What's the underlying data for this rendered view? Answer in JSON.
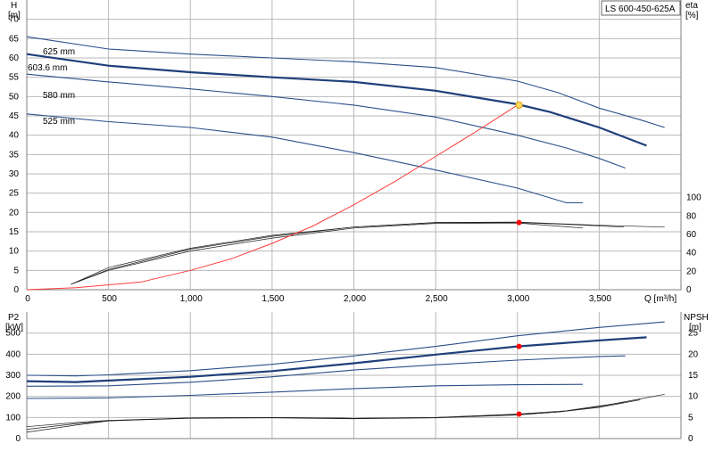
{
  "title": "LS 600-450-625A",
  "chart_data": [
    {
      "type": "line",
      "name": "head",
      "x_axis": {
        "label": "Q [m³/h]",
        "range": [
          0,
          4000
        ],
        "ticks": [
          0,
          500,
          1000,
          1500,
          2000,
          2500,
          3000,
          3500
        ],
        "tick_labels": [
          "0",
          "500",
          "1,000",
          "1,500",
          "2,000",
          "2,500",
          "3,000",
          "3,500"
        ]
      },
      "y_left": {
        "label_line1": "H",
        "label_line2": "[m]",
        "range": [
          0,
          75
        ],
        "ticks": [
          0,
          5,
          10,
          15,
          20,
          25,
          30,
          35,
          40,
          45,
          50,
          55,
          60,
          65,
          70
        ]
      },
      "y_right": {
        "label_line1": "eta",
        "label_line2": "[%]",
        "range": [
          0,
          100
        ],
        "ticks": [
          0,
          20,
          40,
          60,
          80,
          100
        ]
      },
      "grid": true,
      "series": [
        {
          "name": "625 mm",
          "x": [
            0,
            500,
            1000,
            1500,
            2000,
            2500,
            3000,
            3250,
            3500,
            3750,
            3900
          ],
          "y": [
            65.5,
            62.3,
            61,
            60,
            59,
            57.5,
            54,
            51,
            47,
            44,
            42
          ]
        },
        {
          "name": "603.6 mm",
          "x": [
            0,
            500,
            1000,
            1500,
            2000,
            2500,
            3000,
            3200,
            3500,
            3790
          ],
          "y": [
            61,
            58,
            56.3,
            55,
            53.8,
            51.5,
            48,
            46,
            42,
            37.3
          ]
        },
        {
          "name": "580 mm",
          "x": [
            0,
            500,
            1000,
            1500,
            2000,
            2500,
            3000,
            3300,
            3500,
            3660
          ],
          "y": [
            55.8,
            53.8,
            52,
            50,
            47.8,
            44.7,
            40,
            36.7,
            34,
            31.5
          ]
        },
        {
          "name": "525 mm",
          "x": [
            0,
            500,
            1000,
            1500,
            2000,
            2500,
            3000,
            3300,
            3400
          ],
          "y": [
            45.5,
            43.5,
            42,
            39.5,
            35.5,
            31,
            26.3,
            22.5,
            22.5
          ]
        }
      ],
      "efficiency_series": [
        {
          "x": [
            270,
            500,
            1000,
            1500,
            2000,
            2500,
            3000,
            3500,
            3900
          ],
          "y": [
            5.9,
            24,
            45,
            59,
            68,
            73,
            73.5,
            70,
            68
          ]
        },
        {
          "x": [
            270,
            500,
            1000,
            1500,
            2000,
            2500,
            3000,
            3400
          ],
          "y": [
            5.9,
            21,
            42,
            56,
            67,
            72,
            72.5,
            67
          ]
        },
        {
          "x": [
            270,
            500,
            1000,
            1500,
            2000,
            2500,
            3000,
            3300,
            3650
          ],
          "y": [
            5.9,
            22,
            44,
            58,
            68,
            73,
            73,
            71,
            68
          ]
        }
      ],
      "system_curve": {
        "x": [
          0,
          300,
          700,
          1000,
          1250,
          1500,
          1750,
          2000,
          2250,
          2500,
          2750,
          3000
        ],
        "y": [
          0,
          0.5,
          2,
          5,
          8,
          12,
          16.5,
          22,
          28,
          34.5,
          41,
          47.8
        ]
      },
      "operating_point": {
        "q": 3010,
        "h": 47.8,
        "eta": 73
      }
    },
    {
      "type": "line",
      "name": "power_npsh",
      "x_axis": {
        "range": [
          0,
          4000
        ]
      },
      "y_left": {
        "label_line1": "P2",
        "label_line2": "[kW]",
        "range": [
          0,
          600
        ],
        "ticks": [
          0,
          100,
          200,
          300,
          400,
          500
        ]
      },
      "y_right": {
        "label_line1": "NPSH",
        "label_line2": "[m]",
        "range": [
          0,
          30
        ],
        "ticks": [
          0,
          5,
          10,
          15,
          20,
          25
        ]
      },
      "grid": true,
      "series": [
        {
          "name": "625 mm",
          "x": [
            0,
            300,
            500,
            1000,
            1500,
            2000,
            2500,
            3000,
            3500,
            3900
          ],
          "y": [
            300,
            297,
            302,
            322,
            352,
            392,
            437,
            487,
            527,
            553
          ]
        },
        {
          "name": "603.6 mm",
          "x": [
            0,
            300,
            500,
            1000,
            1500,
            2000,
            2500,
            3000,
            3500,
            3790
          ],
          "y": [
            272,
            268,
            275,
            293,
            320,
            357,
            398,
            437,
            465,
            480
          ]
        },
        {
          "name": "580 mm",
          "x": [
            0,
            500,
            1000,
            1500,
            2000,
            2500,
            3000,
            3500,
            3660
          ],
          "y": [
            248,
            250,
            267,
            293,
            325,
            350,
            372,
            389,
            392
          ]
        },
        {
          "name": "525 mm",
          "x": [
            0,
            500,
            1000,
            1500,
            2000,
            2500,
            3000,
            3400
          ],
          "y": [
            190,
            193,
            205,
            220,
            237,
            250,
            255,
            257
          ]
        }
      ],
      "npsh_series": [
        {
          "x": [
            0,
            300,
            500,
            1000,
            1500,
            2000,
            2500,
            3000,
            3250,
            3500,
            3750,
            3900
          ],
          "y": [
            1.5,
            3.2,
            4.2,
            4.9,
            5,
            4.8,
            5,
            5.7,
            6.3,
            7.6,
            9.4,
            10.5
          ]
        },
        {
          "x": [
            0,
            300,
            500,
            1000,
            1500,
            2000,
            2500,
            3000,
            3250,
            3500,
            3750
          ],
          "y": [
            2.2,
            3.5,
            4.2,
            4.8,
            4.9,
            4.7,
            4.9,
            5.6,
            6.3,
            7.4,
            9.2
          ]
        },
        {
          "x": [
            0,
            300,
            500,
            1000,
            1500,
            2000,
            2500,
            3000,
            3300,
            3650
          ],
          "y": [
            2.8,
            3.8,
            4.3,
            4.9,
            5,
            4.8,
            5,
            5.8,
            6.6,
            8.6
          ]
        }
      ],
      "operating_point": {
        "q": 3010,
        "p2": 437,
        "npsh": 5.8
      }
    }
  ],
  "colors": {
    "pump_curve": "#2c4f8a",
    "operating_curve": "#1e3f7a",
    "system_curve": "#ff3b3b",
    "grid": "#b9b9b9",
    "efficiency": "#202020",
    "op_point_top": "#ffd966",
    "op_point_marker": "#ff0000"
  }
}
